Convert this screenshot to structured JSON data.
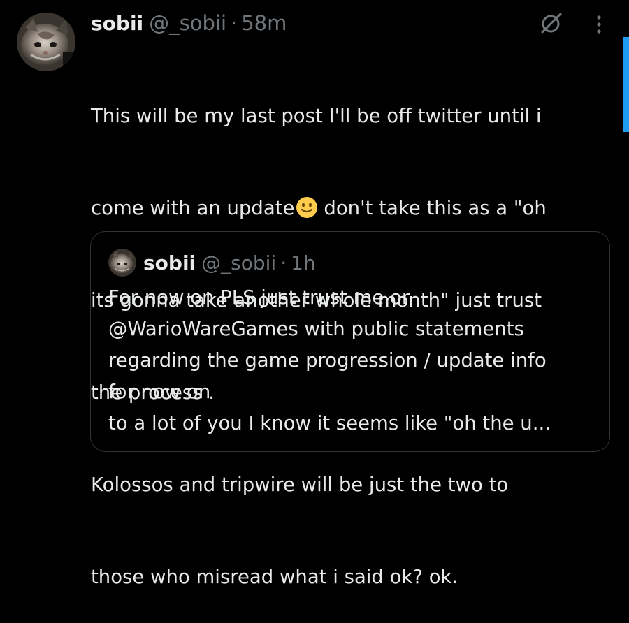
{
  "post": {
    "author": {
      "display_name": "sobii",
      "handle": "@_sobii",
      "separator": "·",
      "time": "58m",
      "avatar_icon": "cat-avatar-icon"
    },
    "text_lines": [
      "This will be my last post I'll be off twitter until i",
      "come with an update",
      "don't take this as a \"oh",
      "its gonna take another whole month\" just trust",
      "the process .",
      "Kolossos and tripwire will be just the two to",
      "those who misread what i said ok? ok."
    ],
    "emoji": "slightly-smiling-face-icon"
  },
  "icons": {
    "grok": "grok-icon",
    "more": "more-options-icon"
  },
  "quote": {
    "author": {
      "display_name": "sobii",
      "handle": "@_sobii",
      "separator": "·",
      "time": "1h"
    },
    "text_lines": [
      "For now on PLS just trust me or",
      "@WarioWareGames with public statements",
      "regarding the game progression / update info",
      "for now on",
      "to a lot of you I know it seems like \"oh the u..."
    ]
  },
  "colors": {
    "background": "#000000",
    "text": "#e7e9ea",
    "secondary": "#71767b",
    "border": "#2f3336",
    "accent": "#1d9bf0"
  }
}
